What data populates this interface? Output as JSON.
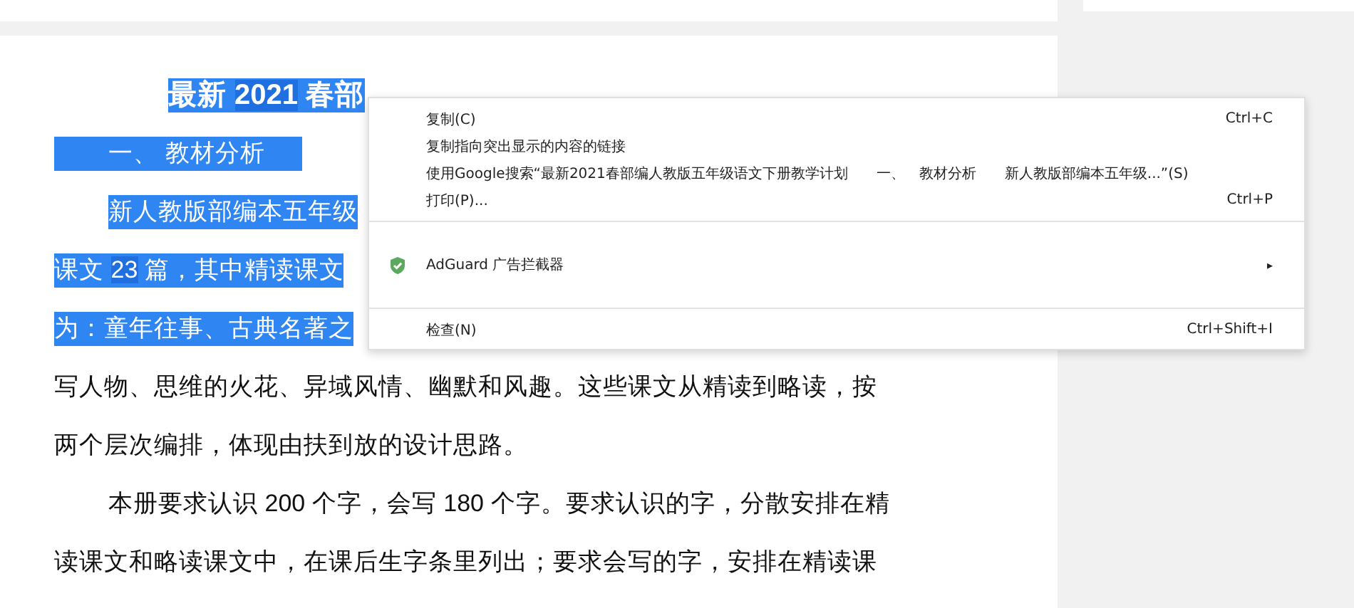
{
  "document": {
    "lines": [
      {
        "kind": "title",
        "selected": true,
        "segments": [
          {
            "text": "最新 ",
            "latin": false
          },
          {
            "text": "2021",
            "latin": true
          },
          {
            "text": " 春部",
            "latin": false
          }
        ]
      },
      {
        "kind": "heading",
        "selected": true,
        "segments": [
          {
            "text": "一、 教材分析",
            "latin": false
          }
        ]
      },
      {
        "kind": "paragraph_start",
        "selected": true,
        "segments": [
          {
            "text": "新人教版部编本五年级",
            "latin": false
          }
        ]
      },
      {
        "kind": "continuation",
        "selected": true,
        "segments": [
          {
            "text": "课文 ",
            "latin": false
          },
          {
            "text": "23",
            "latin": true
          },
          {
            "text": " 篇，其中精读课文",
            "latin": false
          }
        ]
      },
      {
        "kind": "continuation",
        "selected": true,
        "segments": [
          {
            "text": "为：童年往事、古典名著之",
            "latin": false
          }
        ]
      },
      {
        "kind": "continuation",
        "selected": false,
        "segments": [
          {
            "text": "写人物、思维的火花、异域风情、幽默和风趣。这些课文从精读到略读，按",
            "latin": false
          }
        ]
      },
      {
        "kind": "continuation",
        "selected": false,
        "segments": [
          {
            "text": "两个层次编排，体现由扶到放的设计思路。",
            "latin": false
          }
        ]
      },
      {
        "kind": "paragraph_start",
        "selected": false,
        "segments": [
          {
            "text": "本册要求认识 ",
            "latin": false
          },
          {
            "text": "200",
            "latin": true
          },
          {
            "text": " 个字，会写 ",
            "latin": false
          },
          {
            "text": "180",
            "latin": true
          },
          {
            "text": " 个字。要求认识的字，分散安排在精",
            "latin": false
          }
        ]
      },
      {
        "kind": "continuation",
        "selected": false,
        "segments": [
          {
            "text": "读课文和略读课文中，在课后生字条里列出；要求会写的字，安排在精读课",
            "latin": false
          }
        ]
      }
    ]
  },
  "context_menu": {
    "items": [
      {
        "kind": "item",
        "label": "复制(C)",
        "shortcut": "Ctrl+C"
      },
      {
        "kind": "item",
        "label": "复制指向突出显示的内容的链接"
      },
      {
        "kind": "item",
        "label": "使用Google搜索“最新2021春部编人教版五年级语文下册教学计划　　一、　教材分析　　新人教版部编本五年级...”(S)"
      },
      {
        "kind": "item",
        "label": "打印(P)...",
        "shortcut": "Ctrl+P"
      },
      {
        "kind": "separator"
      },
      {
        "kind": "submenu",
        "label": "AdGuard 广告拦截器",
        "arrow": "▸"
      },
      {
        "kind": "separator"
      },
      {
        "kind": "item",
        "label": "检查(N)",
        "shortcut": "Ctrl+Shift+I"
      }
    ]
  }
}
